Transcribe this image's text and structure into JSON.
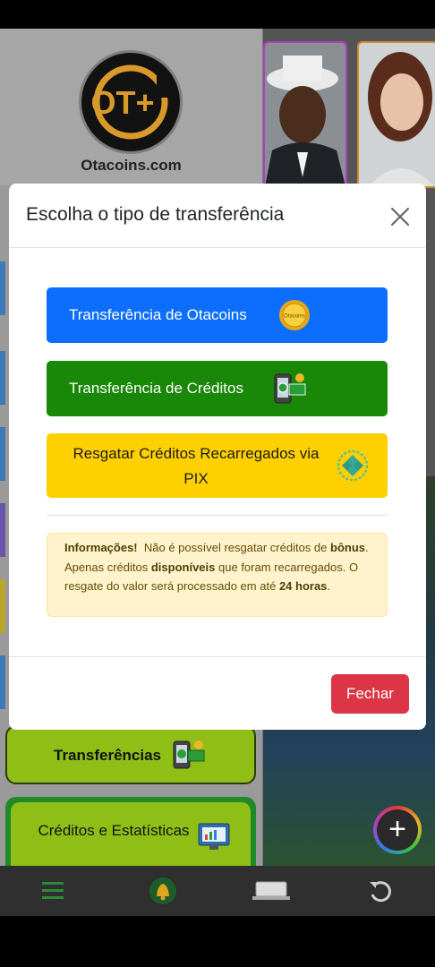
{
  "background": {
    "site_name": "Otacoins.com",
    "logo_text": "OT+",
    "menu": {
      "transfers_label": "Transferências",
      "credits_stats_label": "Créditos e Estatísticas"
    }
  },
  "modal": {
    "title": "Escolha o tipo de transferência",
    "close_icon": "close-icon",
    "buttons": [
      {
        "label": "Transferência de Otacoins",
        "color": "#0d6efd",
        "icon": "otacoins-coin-icon",
        "coin_text": "Otacoins"
      },
      {
        "label": "Transferência de Créditos",
        "color": "#198708",
        "icon": "phone-money-icon"
      },
      {
        "label": "Resgatar Créditos Recarregados via PIX",
        "color": "#ffd000",
        "icon": "pix-icon"
      }
    ],
    "info": {
      "strong_label": "Informações!",
      "text_1": "Não é possível resgatar créditos de",
      "bonus": "bônus",
      "text_2": ". Apenas créditos",
      "available": "disponíveis",
      "text_3": "que foram recarregados. O resgate do valor será processado em até",
      "hours": "24 horas",
      "text_4": "."
    },
    "footer_button": {
      "label": "Fechar",
      "color": "#dc3545"
    }
  },
  "bottom_nav": {
    "items": [
      "menu-icon",
      "bell-icon",
      "laptop-icon",
      "refresh-icon"
    ]
  },
  "colors": {
    "accent_green": "#8fbf16",
    "primary_blue": "#0d6efd",
    "danger_red": "#dc3545"
  }
}
